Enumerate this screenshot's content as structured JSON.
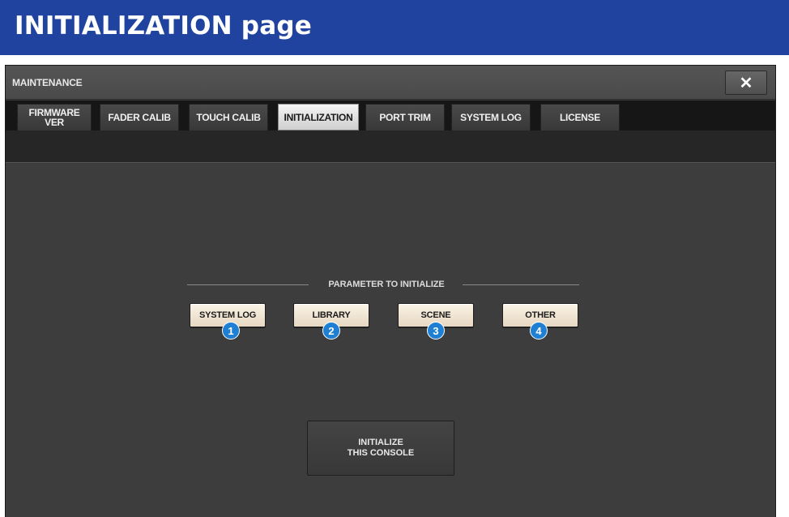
{
  "doc": {
    "heading": "INITIALIZATION page"
  },
  "window": {
    "title": "MAINTENANCE",
    "close_glyph": "✕"
  },
  "tabs": [
    {
      "line1": "FIRMWARE",
      "line2": "VER",
      "active": false
    },
    {
      "line1": "FADER CALIB",
      "line2": "",
      "active": false
    },
    {
      "line1": "TOUCH CALIB",
      "line2": "",
      "active": false
    },
    {
      "line1": "INITIALIZATION",
      "line2": "",
      "active": true
    },
    {
      "line1": "PORT TRIM",
      "line2": "",
      "active": false
    },
    {
      "line1": "SYSTEM LOG",
      "line2": "",
      "active": false
    },
    {
      "line1": "LICENSE",
      "line2": "",
      "active": false
    }
  ],
  "section": {
    "label": "PARAMETER TO INITIALIZE"
  },
  "params": [
    {
      "label": "SYSTEM LOG",
      "badge": "1"
    },
    {
      "label": "LIBRARY",
      "badge": "2"
    },
    {
      "label": "SCENE",
      "badge": "3"
    },
    {
      "label": "OTHER",
      "badge": "4"
    }
  ],
  "initialize": {
    "line1": "INITIALIZE",
    "line2": "THIS CONSOLE"
  },
  "colors": {
    "header_blue": "#2143a0",
    "badge_blue": "#1f7fd2",
    "panel": "#3d3d3d",
    "button_cream": "#f4ead8"
  }
}
